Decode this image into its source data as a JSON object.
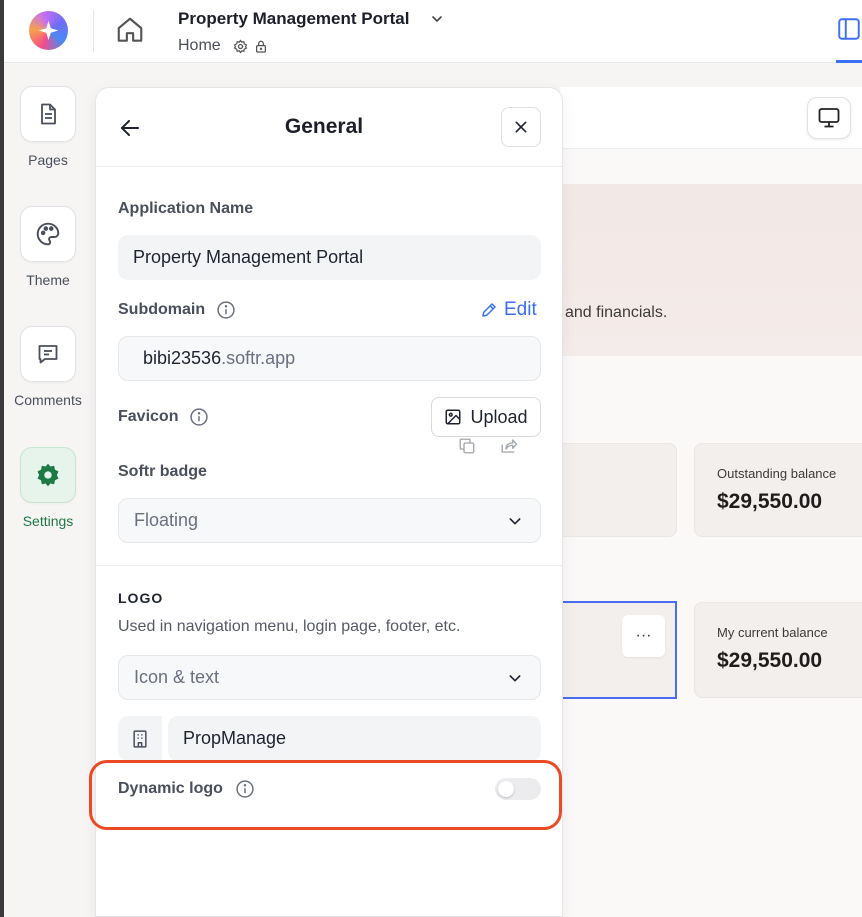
{
  "header": {
    "app_title": "Property Management Portal",
    "breadcrumb_page": "Home"
  },
  "rail": {
    "items": [
      {
        "label": "Pages",
        "icon": "file-text-icon"
      },
      {
        "label": "Theme",
        "icon": "palette-icon"
      },
      {
        "label": "Comments",
        "icon": "message-square-icon"
      },
      {
        "label": "Settings",
        "icon": "gear-icon",
        "active": true
      }
    ]
  },
  "panel": {
    "title": "General",
    "app_name_label": "Application Name",
    "app_name_value": "Property Management Portal",
    "subdomain_label": "Subdomain",
    "edit_label": "Edit",
    "subdomain_prefix": "bibi23536",
    "subdomain_suffix": ".softr.app",
    "favicon_label": "Favicon",
    "upload_label": "Upload",
    "badge_label": "Softr badge",
    "badge_value": "Floating",
    "logo_section_title": "LOGO",
    "logo_section_desc": "Used in navigation menu, login page, footer, etc.",
    "logo_type_value": "Icon & text",
    "logo_text_value": "PropManage",
    "dynamic_logo_label": "Dynamic logo",
    "dynamic_logo_enabled": false
  },
  "preview": {
    "hero_text": "and financials.",
    "cards": [
      {
        "caption": "Outstanding balance",
        "amount": "$29,550.00"
      },
      {
        "caption": "My current balance",
        "amount": "$29,550.00"
      }
    ],
    "more_label": "···"
  },
  "colors": {
    "accent": "#3b6ff5",
    "settings_active": "#1e7a45",
    "highlight": "#ec4a24"
  }
}
